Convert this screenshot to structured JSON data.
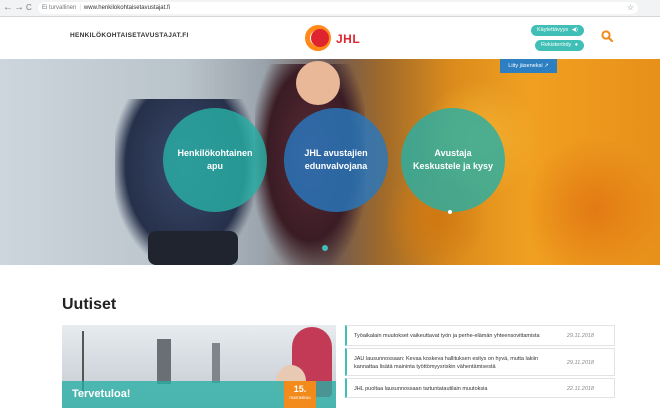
{
  "browser": {
    "security_label": "Ei turvallinen",
    "url": "www.henkilokohtaisetavustajat.fi",
    "back_glyph": "←",
    "forward_glyph": "→",
    "reload_glyph": "C",
    "bookmark_glyph": "☆"
  },
  "header": {
    "site_name": "HENKILÖKOHTAISETAVUSTAJAT.FI",
    "logo_text": "JHL",
    "accessibility_label": "Käytettävyys",
    "register_label": "Rekisteröidy",
    "join_label": "Liity jäseneksi"
  },
  "hero": {
    "circles": [
      {
        "label": "Henkilökohtainen apu"
      },
      {
        "label": "JHL avustajien edunvalvojana"
      },
      {
        "label": "Avustaja Keskustele ja kysy"
      }
    ]
  },
  "news": {
    "section_title": "Uutiset",
    "featured": {
      "label": "Tervetuloa!",
      "date_day": "15.",
      "date_month": "marraskuu"
    },
    "items": [
      {
        "title": "Työaikalain muutokset vaikeuttavat työn ja perhe-elämän yhteensovittamista",
        "date": "29.11.2018"
      },
      {
        "title": "JAU lausunnossaan: Kevaa koskeva hallituksen esitys on hyvä, mutta lakiin kannattaa lisätä maininta työttömyysriskin vähentämisestä",
        "date": "29.11.2018"
      },
      {
        "title": "JHL puoltaa lausunnossaan tartuntatautilain muutoksia",
        "date": "22.11.2018"
      }
    ]
  },
  "colors": {
    "teal": "#3fbfb5",
    "blue": "#2d7fc1",
    "orange": "#f28a1c",
    "red": "#e0242f"
  }
}
